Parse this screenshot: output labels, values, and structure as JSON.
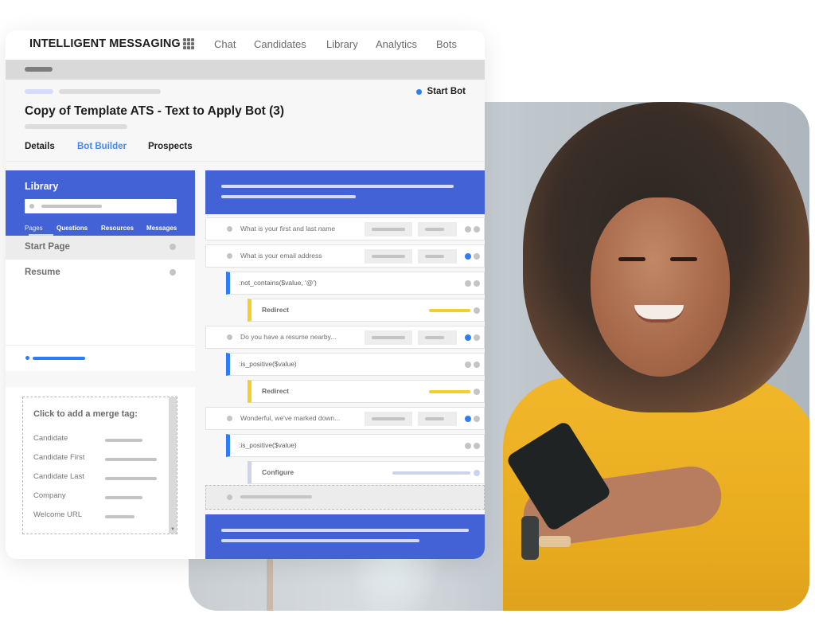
{
  "app": {
    "brand": "INTELLIGENT MESSAGING",
    "nav": [
      "Chat",
      "Candidates",
      "Library",
      "Analytics",
      "Bots"
    ],
    "apps_icon": "grid-icon"
  },
  "bot": {
    "title": "Copy of Template ATS - Text to Apply Bot (3)",
    "start_label": "Start Bot",
    "tabs": [
      "Details",
      "Bot Builder",
      "Prospects"
    ],
    "active_tab": "Bot Builder"
  },
  "library": {
    "title": "Library",
    "tabs": [
      "Pages",
      "Questions",
      "Resources",
      "Messages"
    ],
    "active_tab": "Pages",
    "items": [
      "Start Page",
      "Resume"
    ],
    "selected_item": "Start Page"
  },
  "merge_tags": {
    "title": "Click to add a merge tag:",
    "items": [
      "Candidate",
      "Candidate First",
      "Candidate Last",
      "Company",
      "Welcome URL"
    ]
  },
  "builder": {
    "nodes": [
      {
        "type": "question",
        "text": "What is your first and last name",
        "active": false
      },
      {
        "type": "question",
        "text": "What is your email address",
        "active": true
      },
      {
        "type": "condition",
        "text": ":not_contains($value, '@')"
      },
      {
        "type": "action",
        "text": "Redirect",
        "style": "yellow"
      },
      {
        "type": "question",
        "text": "Do you have a resume nearby...",
        "active": true
      },
      {
        "type": "condition",
        "text": ":is_positive($value)"
      },
      {
        "type": "action",
        "text": "Redirect",
        "style": "yellow"
      },
      {
        "type": "question",
        "text": "Wonderful, we've marked down...",
        "active": true
      },
      {
        "type": "condition",
        "text": ":is_positive($value)"
      },
      {
        "type": "action",
        "text": "Configure",
        "style": "lavender"
      }
    ]
  },
  "colors": {
    "primary_blue": "#4262d6",
    "accent_blue": "#2f7df6",
    "redirect_yellow": "#f2cf2b",
    "configure_lavender": "#cdd3ee"
  }
}
